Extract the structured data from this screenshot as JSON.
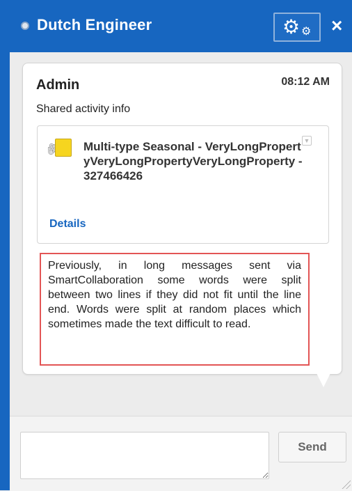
{
  "header": {
    "title": "Dutch Engineer",
    "gear_icon": "gear-icon",
    "close_icon": "close-icon",
    "close_glyph": "×",
    "accent_color": "#1766c0"
  },
  "message_card": {
    "sender": "Admin",
    "time": "08:12 AM",
    "subtitle": "Shared activity info",
    "attachment": {
      "title": "Multi-type Seasonal - VeryLongPropertyVeryLongPropertyVeryLongProperty - 327466426",
      "details_label": "Details"
    },
    "body": "Previously, in long messages sent via SmartCollaboration some words were split between two lines if they did not fit until the line end. Words were split at random places which sometimes made the text difficult to read."
  },
  "composer": {
    "input_value": "",
    "send_label": "Send"
  }
}
